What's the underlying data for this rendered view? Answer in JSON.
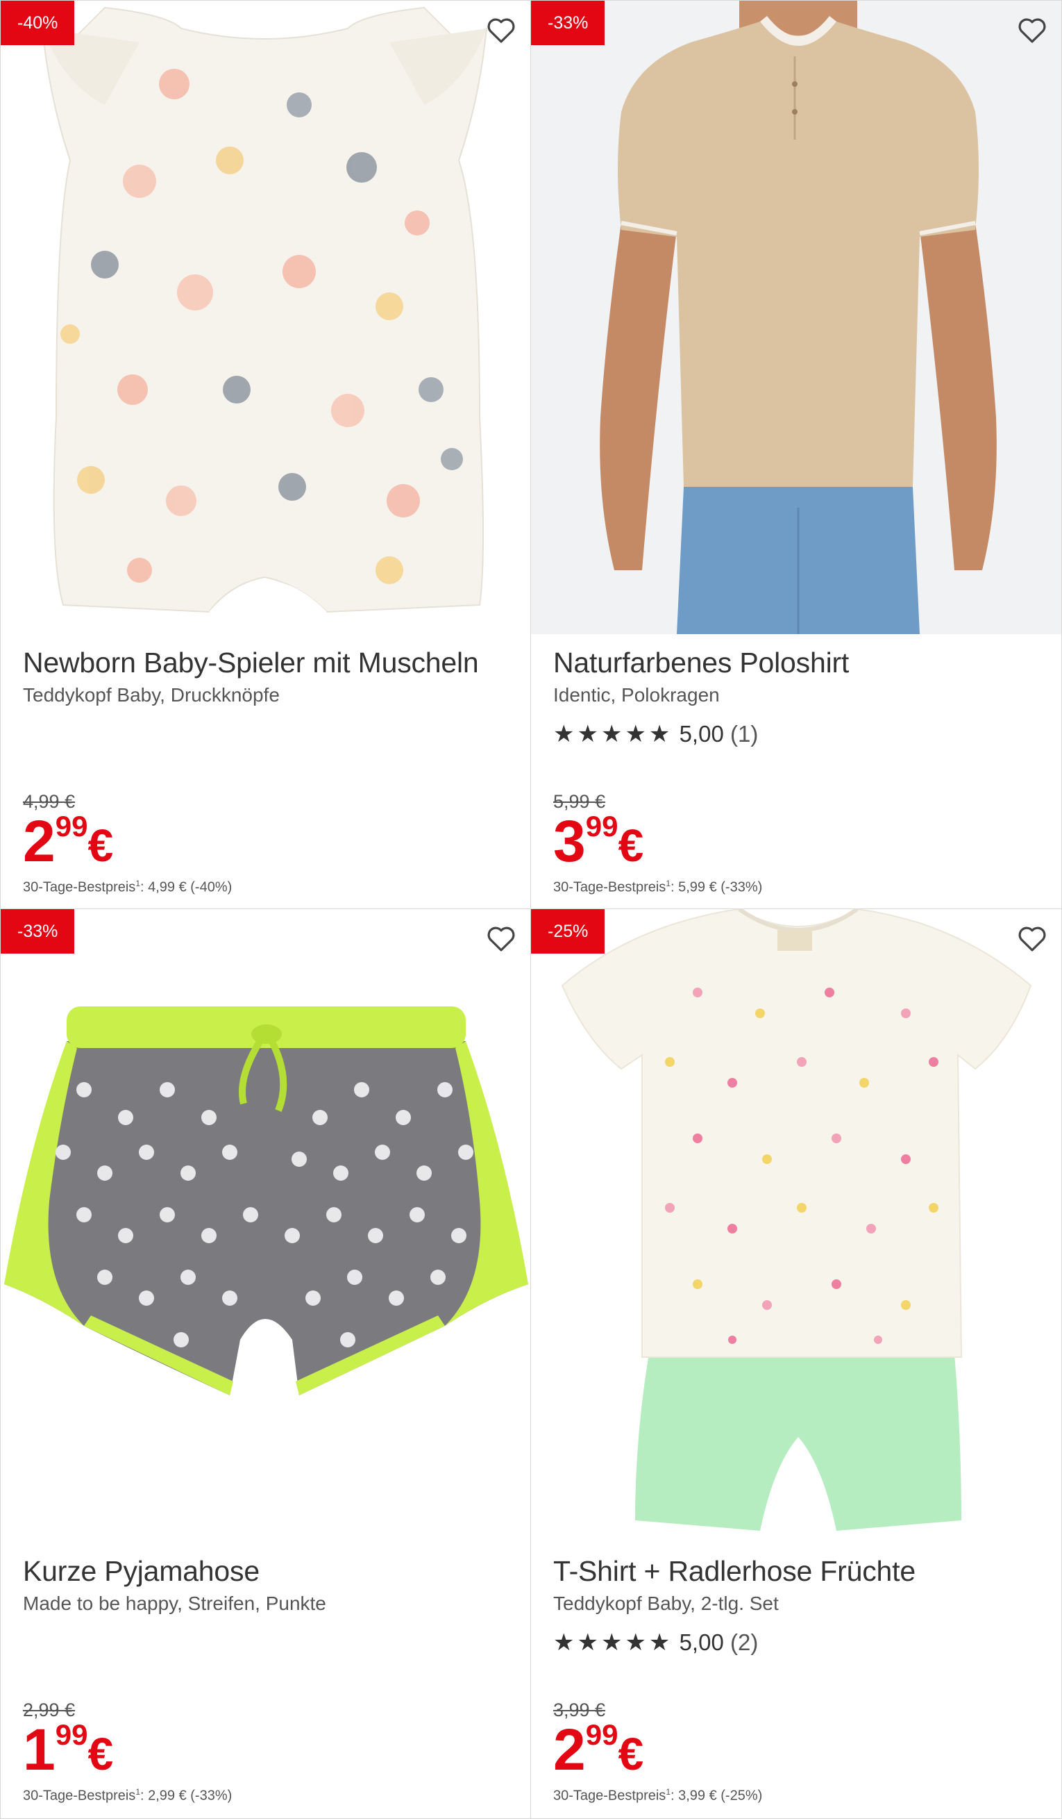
{
  "products": [
    {
      "badge": "-40%",
      "title": "Newborn Baby-Spieler mit Muscheln",
      "subtitle": "Teddykopf Baby, Druckknöpfe",
      "old_price": "4,99 €",
      "price_main": "2",
      "price_cents": "99",
      "currency": "€",
      "best_label": "30-Tage-Bestpreis",
      "best_sup": "1",
      "best_value": ": 4,99 € (-40%)"
    },
    {
      "badge": "-33%",
      "title": "Naturfarbenes Poloshirt",
      "subtitle": "Identic, Polokragen",
      "stars": "★★★★★",
      "rating_value": "5,00",
      "rating_count": "(1)",
      "old_price": "5,99 €",
      "price_main": "3",
      "price_cents": "99",
      "currency": "€",
      "best_label": "30-Tage-Bestpreis",
      "best_sup": "1",
      "best_value": ": 5,99 € (-33%)"
    },
    {
      "badge": "-33%",
      "title": "Kurze Pyjamahose",
      "subtitle": "Made to be happy, Streifen, Punkte",
      "old_price": "2,99 €",
      "price_main": "1",
      "price_cents": "99",
      "currency": "€",
      "best_label": "30-Tage-Bestpreis",
      "best_sup": "1",
      "best_value": ": 2,99 € (-33%)"
    },
    {
      "badge": "-25%",
      "title": "T-Shirt + Radlerhose Früchte",
      "subtitle": "Teddykopf Baby, 2-tlg. Set",
      "stars": "★★★★★",
      "rating_value": "5,00",
      "rating_count": "(2)",
      "old_price": "3,99 €",
      "price_main": "2",
      "price_cents": "99",
      "currency": "€",
      "best_label": "30-Tage-Bestpreis",
      "best_sup": "1",
      "best_value": ": 3,99 € (-25%)"
    }
  ],
  "colors": {
    "sale_red": "#e30613",
    "text": "#333333",
    "muted": "#555555",
    "border": "#d9d9d9"
  },
  "icons": {
    "wishlist": "heart-outline-icon",
    "rating": "star-icon"
  }
}
